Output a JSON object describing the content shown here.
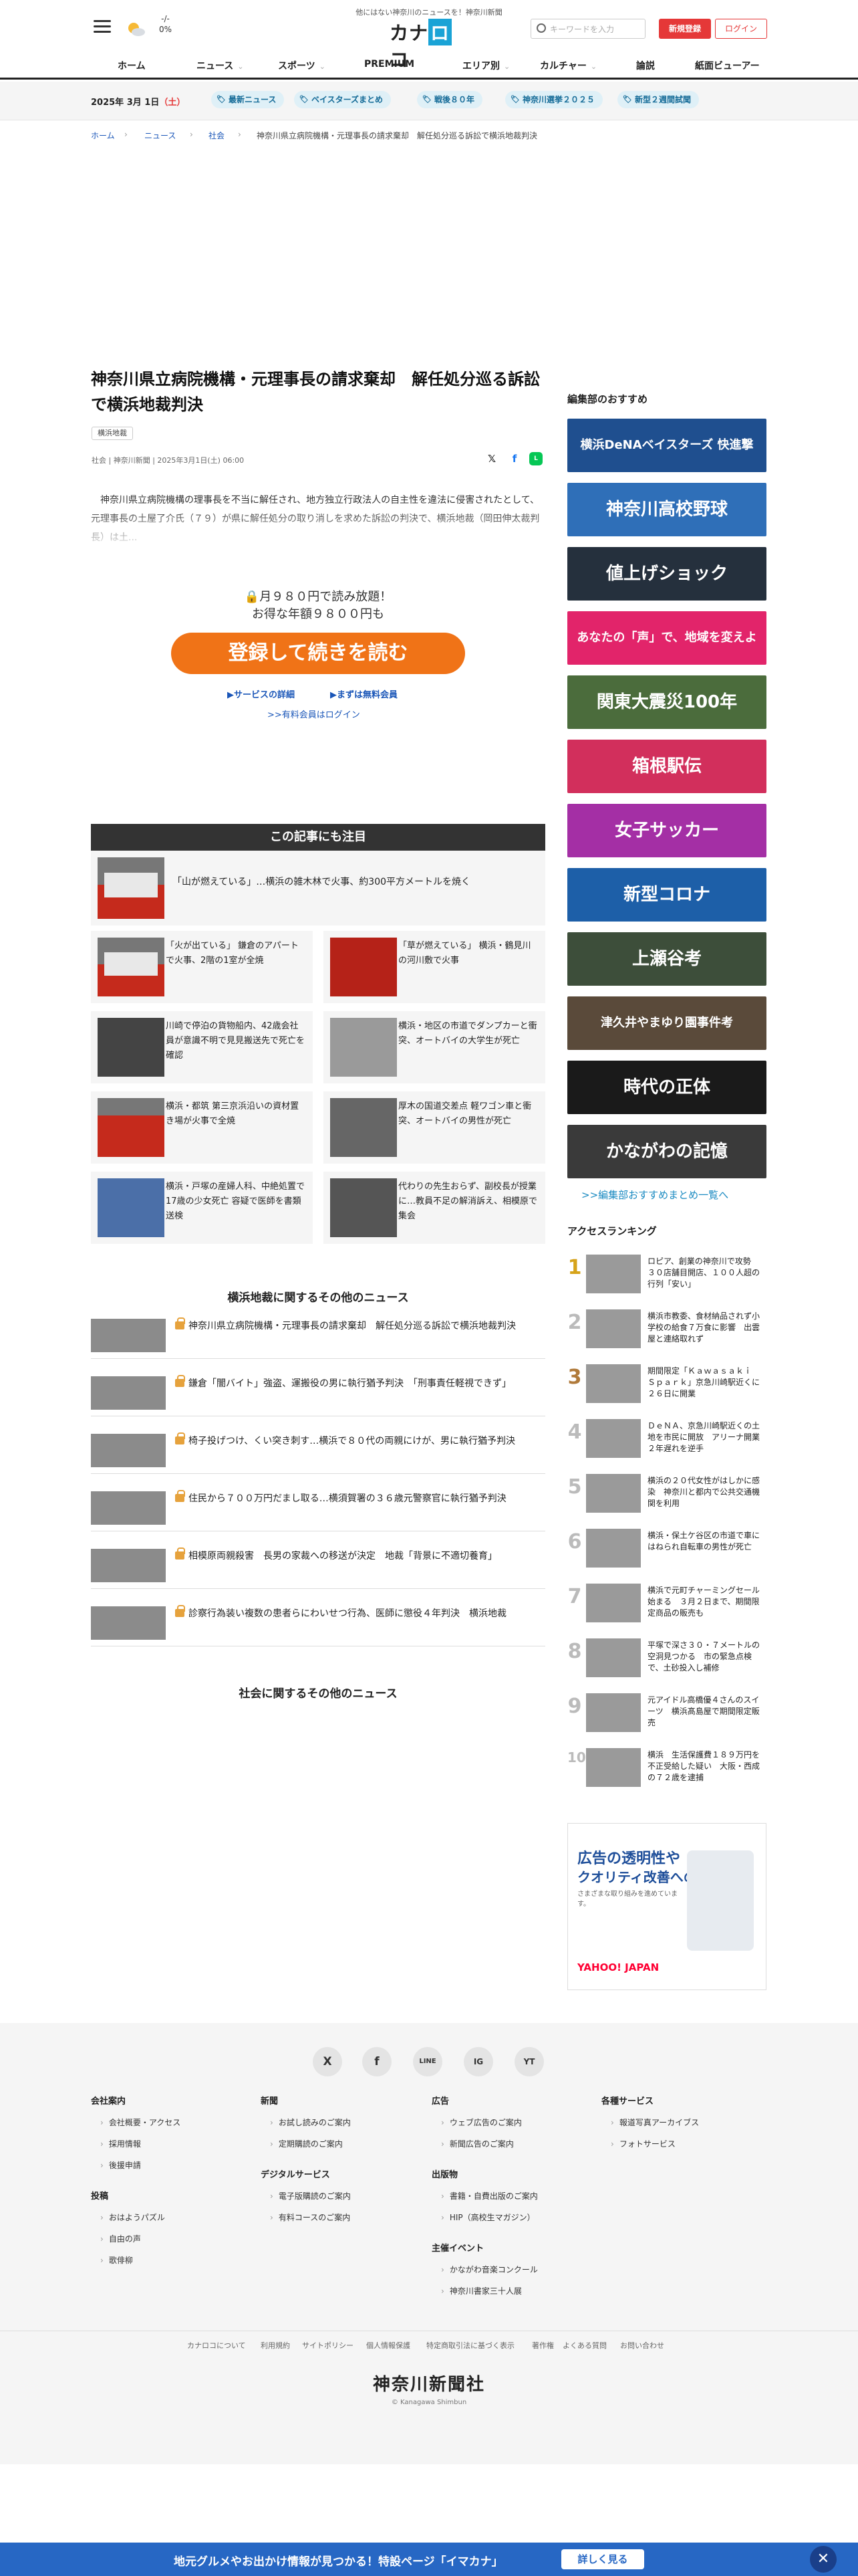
{
  "header": {
    "tagline": "他にはない神奈川のニュースを！神奈川新聞",
    "logo_text": "カナロコ",
    "logo_mark": "ロ",
    "weather_temp_top": "-/-",
    "weather_temp_bottom": "0%",
    "search_placeholder": "キーワードを入力",
    "register": "新規登録",
    "login": "ログイン",
    "nav": [
      "ホーム",
      "ニュース",
      "スポーツ",
      "PREMIUM",
      "エリア別",
      "カルチャー",
      "論説",
      "紙面ビューアー"
    ]
  },
  "topics": {
    "date_prefix": "2025年 3月 1日",
    "date_day": "（土）",
    "pills": [
      "最新ニュース",
      "ベイスターズまとめ",
      "戦後８０年",
      "神奈川選挙２０２５",
      "新型２週間試聞"
    ]
  },
  "breadcrumb": [
    "ホーム",
    "ニュース",
    "社会",
    "神奈川県立病院機構・元理事長の請求棄却　解任処分巡る訴訟で横浜地裁判決"
  ],
  "article": {
    "headline": "神奈川県立病院機構・元理事長の請求棄却　解任処分巡る訴訟で横浜地裁判決",
    "badge": "横浜地裁",
    "meta": "社会 | 神奈川新聞 | 2025年3月1日(土) 06:00",
    "lead": "神奈川県立病院機構の理事長を不当に解任され、地方独立行政法人の自主性を違法に侵害されたとして、元理事長の土屋了介氏（７９）が県に解任処分の取り消しを求めた訴訟の判決で、横浜地裁（岡田伸太裁判長）は土..."
  },
  "paywall": {
    "line1": "🔒月９８０円で読み放題！",
    "line2": "お得な年額９８００円も",
    "cta": "登録して続きを読む",
    "link_service": "▶サービスの詳細",
    "link_free": "▶まずは無料会員",
    "link_paid_login": ">>有料会員はログイン"
  },
  "attention": {
    "title": "この記事にも注目",
    "top_item": "「山が燃えている」…横浜の雑木林で火事、約300平方メートルを焼く",
    "items": [
      "「火が出ている」 鎌倉のアパートで火事、2階の1室が全焼",
      "「草が燃えている」 横浜・鶴見川の河川敷で火事",
      "川崎で停泊の貨物船内、42歳会社員が意識不明で見見搬送先で死亡を確認",
      "横浜・地区の市道でダンプカーと衝突、オートバイの大学生が死亡",
      "横浜・都筑 第三京浜沿いの資材置き場が火事で全焼",
      "厚木の国道交差点 軽ワゴン車と衝突、オートバイの男性が死亡",
      "横浜・戸塚の産婦人科、中絶処置で17歳の少女死亡 容疑で医師を書類送検",
      "代わりの先生おらず、副校長が授業に…教員不足の解消訴え、相模原で集会"
    ]
  },
  "related_court": {
    "title": "横浜地裁に関するその他のニュース",
    "items": [
      "神奈川県立病院機構・元理事長の請求棄却　解任処分巡る訴訟で横浜地裁判決",
      "鎌倉「闇バイト」強盗、運搬役の男に執行猶予判決　「刑事責任軽視できず」",
      "椅子投げつけ、くい突き刺す…横浜で８０代の両親にけが、男に執行猶予判決",
      "住民から７００万円だまし取る…横須賀署の３６歳元警察官に執行猶予判決",
      "相模原両親殺害　長男の家裁への移送が決定　地裁「背景に不適切養育」",
      "診察行為装い複数の患者らにわいせつ行為、医師に懲役４年判決　横浜地裁"
    ]
  },
  "related_social_title": "社会に関するその他のニュース",
  "sidebar": {
    "picks_title": "編集部のおすすめ",
    "banners": [
      {
        "text": "横浜DeNAベイスターズ 快進撃",
        "color": "#1f4f8f"
      },
      {
        "text": "神奈川高校野球",
        "color": "#2f6fb8"
      },
      {
        "text": "値上げショック",
        "color": "#25303d"
      },
      {
        "text": "あなたの「声」で、地域を変えよう。",
        "color": "#e2246a"
      },
      {
        "text": "関東大震災100年",
        "color": "#4b6c3c"
      },
      {
        "text": "箱根駅伝",
        "color": "#d22f5c"
      },
      {
        "text": "女子サッカー",
        "color": "#a42fa5"
      },
      {
        "text": "新型コロナ",
        "color": "#1d5fa8"
      },
      {
        "text": "上瀬谷考",
        "color": "#3d4e3a"
      },
      {
        "text": "津久井やまゆり園事件考",
        "color": "#5a4a3a"
      },
      {
        "text": "時代の正体",
        "color": "#1a1a1a"
      },
      {
        "text": "かながわの記憶",
        "color": "#3a3a3a"
      }
    ],
    "picks_more": ">>編集部おすすめまとめ一覧へ",
    "ranking_title": "アクセスランキング",
    "ranking": [
      {
        "n": "1",
        "text": "ロピア、創業の神奈川で攻勢　３０店舗目開店、１００人超の行列「安い」"
      },
      {
        "n": "2",
        "text": "横浜市教委、食材納品されず小学校の給食７万食に影響　出雲屋と連絡取れず"
      },
      {
        "n": "3",
        "text": "期間限定「Ｋａｗａｓａｋｉ　Ｓｐａｒｋ」京急川崎駅近くに２６日に開業"
      },
      {
        "n": "4",
        "text": "ＤｅＮＡ、京急川崎駅近くの土地を市民に開放　アリーナ開業２年遅れを逆手"
      },
      {
        "n": "5",
        "text": "横浜の２０代女性がはしかに感染　神奈川と都内で公共交通機関を利用"
      },
      {
        "n": "6",
        "text": "横浜・保土ケ谷区の市道で車にはねられ自転車の男性が死亡"
      },
      {
        "n": "7",
        "text": "横浜で元町チャーミングセール始まる　３月２日まで、期間限定商品の販売も"
      },
      {
        "n": "8",
        "text": "平塚で深さ３０・７メートルの空洞見つかる　市の緊急点検で、土砂投入し補修"
      },
      {
        "n": "9",
        "text": "元アイドル高橋優４さんのスイーツ　横浜髙島屋で期間限定販売"
      },
      {
        "n": "10",
        "text": "横浜　生活保護費１８９万円を不正受給した疑い　大阪・西成の７２歳を逮捕"
      }
    ],
    "ad": {
      "line1": "広告の透明性や",
      "line2": "クオリティ改善への",
      "line3": "さまざまな取り組みを進めています。",
      "brand": "YAHOO! JAPAN"
    }
  },
  "footer": {
    "social": [
      "X",
      "f",
      "LINE",
      "IG",
      "YT"
    ],
    "columns": [
      {
        "head": "会社案内",
        "items": [
          "会社概要・アクセス",
          "採用情報",
          "後援申請"
        ]
      },
      {
        "head": "新聞",
        "items": [
          "お試し読みのご案内",
          "定期購読のご案内"
        ]
      },
      {
        "head": "広告",
        "items": [
          "ウェブ広告のご案内",
          "新聞広告のご案内"
        ]
      },
      {
        "head": "各種サービス",
        "items": [
          "報道写真アーカイブス",
          "フォトサービス"
        ]
      }
    ],
    "col_pazzle": {
      "head": "投稿",
      "items": [
        "おはようパズル",
        "自由の声",
        "歌俳柳"
      ]
    },
    "col_digital": {
      "head": "デジタルサービス",
      "items": [
        "電子版購読のご案内",
        "有料コースのご案内"
      ]
    },
    "col_pub": {
      "head": "出版物",
      "items": [
        "書籍・自費出版のご案内",
        "HIP（高校生マガジン）"
      ]
    },
    "col_event": {
      "head": "主催イベント",
      "items": [
        "かながわ音楽コンクール",
        "神奈川書家三十人展"
      ]
    },
    "links": [
      "カナロコについて",
      "利用規約",
      "サイトポリシー",
      "個人情報保護",
      "特定商取引法に基づく表示",
      "著作権",
      "よくある質問",
      "お問い合わせ"
    ],
    "logo": "神奈川新聞社",
    "copyright": "© Kanagawa Shimbun"
  },
  "bottom_bar": {
    "text": "地元グルメやお出かけ情報が見つかる！特設ページ「イマカナ」",
    "button": "詳しく見る",
    "close": "✕"
  },
  "colors": {
    "accent_red": "#e53838",
    "cta_orange": "#f07317",
    "link_blue": "#1a56b8",
    "bar_blue": "#2767c4"
  }
}
